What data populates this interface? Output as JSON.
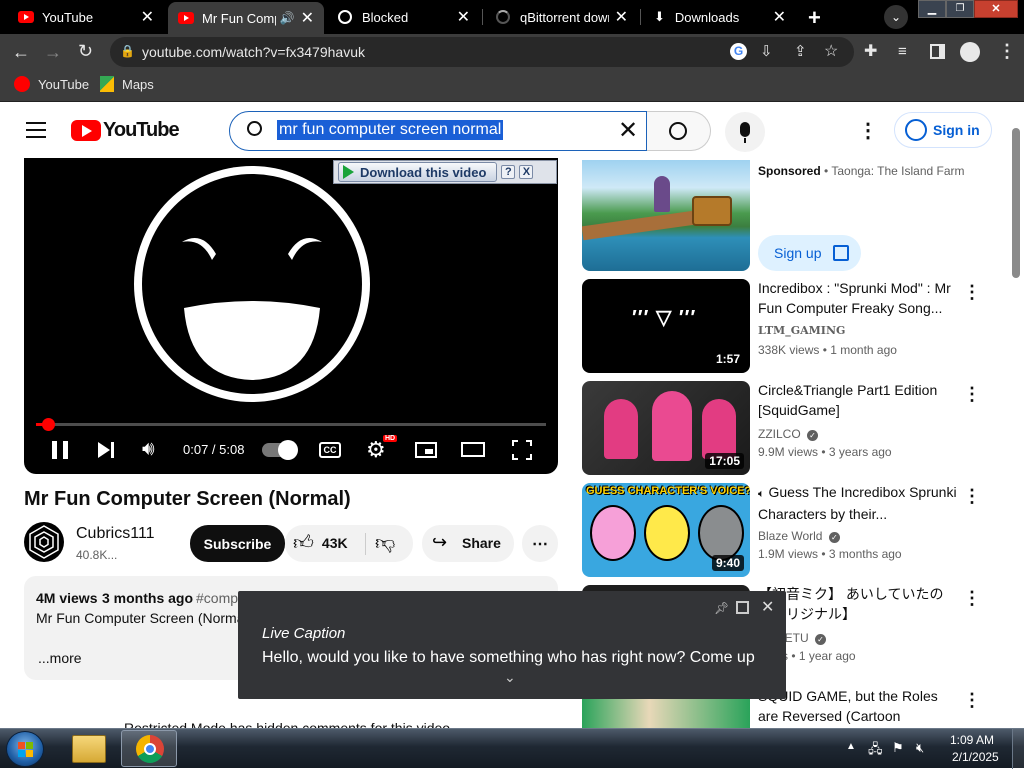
{
  "browser": {
    "tabs": [
      {
        "label": "YouTube",
        "active": false
      },
      {
        "label": "Mr Fun Computer Screen (Normal)",
        "active": true
      },
      {
        "label": "Blocked",
        "active": false
      },
      {
        "label": "qBittorrent download",
        "active": false
      },
      {
        "label": "Downloads",
        "active": false
      }
    ],
    "url": "youtube.com/watch?v=fx3479havuk",
    "bookmarks": [
      "YouTube",
      "Maps"
    ]
  },
  "youtube": {
    "logo_text": "YouTube",
    "search_query": "mr fun computer screen normal",
    "sign_in": "Sign in"
  },
  "player": {
    "download_label": "Download this video",
    "help": "?",
    "close": "X",
    "time": "0:07 / 5:08",
    "progress_fraction": 0.023,
    "hd_badge": "HD",
    "cc_label": "CC"
  },
  "video": {
    "title": "Mr Fun Computer Screen (Normal)",
    "channel": "Cubrics111",
    "subscribers": "40.8K...",
    "subscribe": "Subscribe",
    "likes": "43K",
    "share": "Share",
    "desc_views": "4M views",
    "desc_age": "3 months ago",
    "desc_tags": "#computerscreen #mrfuncomputer #sprunki",
    "desc_text": "Mr Fun Computer Screen (Normal)",
    "desc_more": "...more",
    "comments_notice": "Restricted Mode has hidden comments for this video."
  },
  "sidebar": {
    "sponsored": {
      "label": "Sponsored",
      "advertiser": "Taonga: The Island Farm",
      "cta": "Sign up"
    },
    "videos": [
      {
        "title": "Incredibox : \"Sprunki Mod\" : Mr Fun Computer Freaky Song...",
        "channel": "LTM_GAMING",
        "meta": "338K views • 1 month ago",
        "duration": "1:57"
      },
      {
        "title": "Circle&Triangle Part1 Edition [SquidGame]",
        "channel": "ZZILCO",
        "meta": "9.9M views • 3 years ago",
        "duration": "17:05"
      },
      {
        "title": "Guess The Incredibox Sprunki Characters by their...",
        "channel": "Blaze World",
        "meta": "1.9M views • 3 months ago",
        "duration": "9:40",
        "thumb_text": "GUESS CHARACTER'S VOICE?"
      },
      {
        "title": "【初音ミク】 あいしていたの 【オリジナル】",
        "channel": "MARETU",
        "meta": "views • 1 year ago",
        "duration": ""
      },
      {
        "title": "SQUID GAME, but the Roles are Reversed (Cartoon Animation)",
        "channel": "",
        "meta": "",
        "duration": ""
      }
    ]
  },
  "live_caption": {
    "title": "Live Caption",
    "text": "Hello, would you like to have something who has right now? Come up"
  },
  "taskbar": {
    "time": "1:09 AM",
    "date": "2/1/2025"
  },
  "colors": {
    "yt_red": "#ff0000",
    "link_blue": "#065fd4",
    "chrome_dark": "#3c3c3c"
  }
}
